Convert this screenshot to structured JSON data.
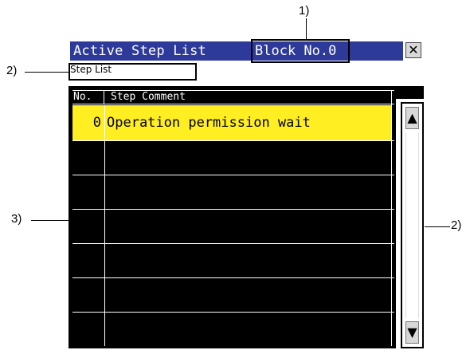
{
  "callouts": {
    "block_no": "1)",
    "step_list": "2)",
    "table": "3)",
    "scrollbar": "2)"
  },
  "window": {
    "title": "Active Step List",
    "block_label": "Block No.0",
    "close_glyph": "✕"
  },
  "step_list_label": "Step List",
  "table": {
    "headers": {
      "no": "No.",
      "comment": "Step Comment"
    },
    "rows": [
      {
        "no": "0",
        "comment": "Operation permission wait",
        "selected": true
      },
      {
        "no": "",
        "comment": ""
      },
      {
        "no": "",
        "comment": ""
      },
      {
        "no": "",
        "comment": ""
      },
      {
        "no": "",
        "comment": ""
      },
      {
        "no": "",
        "comment": ""
      },
      {
        "no": "",
        "comment": ""
      }
    ]
  },
  "scrollbar": {
    "up_glyph": "▲",
    "down_glyph": "▼"
  },
  "colors": {
    "titlebar": "#2e3a9a",
    "selected_row": "#ffee22",
    "table_bg": "#000000",
    "grid": "#ffffff"
  }
}
